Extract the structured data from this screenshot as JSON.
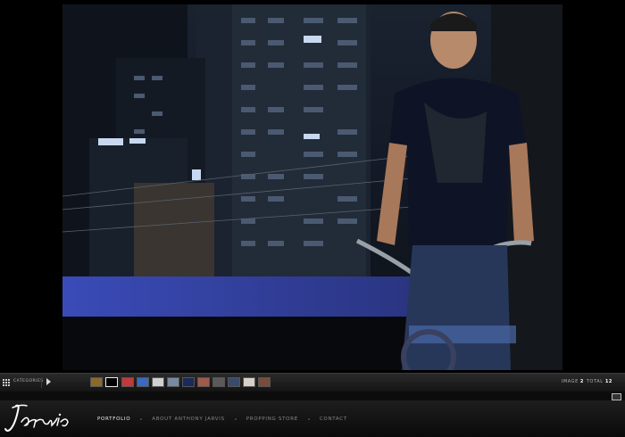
{
  "gallery": {
    "photo_alt": "Man on bicycle in front of city buildings at night",
    "thumbnails": [
      {
        "name": "thumb-1",
        "color": "#8a6a2a"
      },
      {
        "name": "thumb-2",
        "color": "#000000"
      },
      {
        "name": "thumb-3",
        "color": "#c23a3a"
      },
      {
        "name": "thumb-4",
        "color": "#3a6ac2"
      },
      {
        "name": "thumb-5",
        "color": "#d0d0d0"
      },
      {
        "name": "thumb-6",
        "color": "#7a8aa0"
      },
      {
        "name": "thumb-7",
        "color": "#1a2a5a"
      },
      {
        "name": "thumb-8",
        "color": "#a05a4a"
      },
      {
        "name": "thumb-9",
        "color": "#5a5a5a"
      },
      {
        "name": "thumb-10",
        "color": "#3a4a6a"
      },
      {
        "name": "thumb-11",
        "color": "#d8d0c8"
      },
      {
        "name": "thumb-12",
        "color": "#7a4a3a"
      }
    ],
    "active_index": 2
  },
  "toolbar": {
    "categories_label": "CATEGORIES",
    "image_label": "IMAGE",
    "image_value": "2",
    "total_label": "TOTAL",
    "total_value": "12"
  },
  "nav": {
    "logo_text": "Jarvis",
    "items": [
      {
        "label": "PORTFOLIO",
        "active": true
      },
      {
        "label": "ABOUT ANTHONY JARVIS",
        "active": false
      },
      {
        "label": "PROPPING STORE",
        "active": false
      },
      {
        "label": "CONTACT",
        "active": false
      }
    ]
  }
}
